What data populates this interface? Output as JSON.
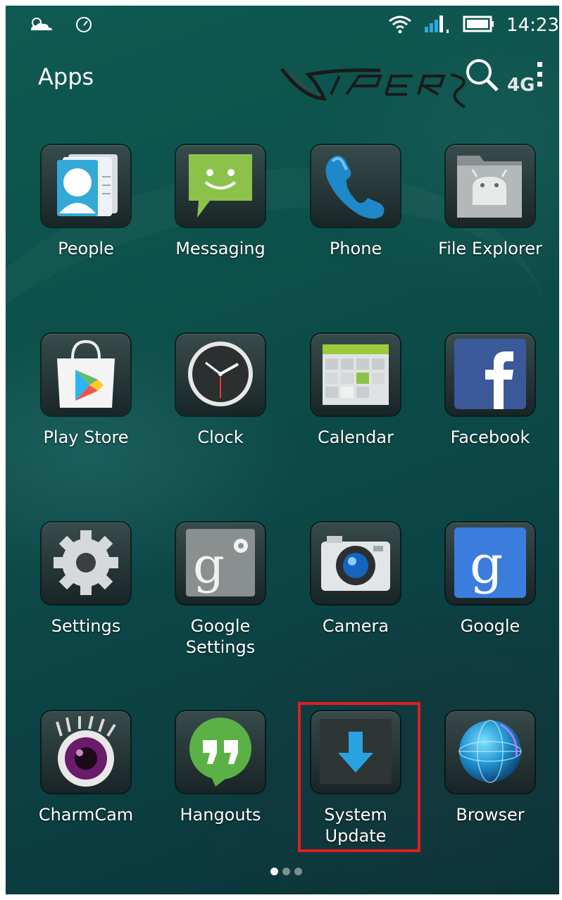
{
  "status_bar": {
    "time": "14:23",
    "icons": [
      "weather-icon",
      "speed-icon",
      "wifi-icon",
      "signal-icon",
      "battery-icon"
    ]
  },
  "header": {
    "title": "Apps",
    "brand": "4G",
    "actions": [
      "search-icon",
      "overflow-menu-icon"
    ]
  },
  "apps": [
    {
      "label": "People",
      "icon": "people-icon"
    },
    {
      "label": "Messaging",
      "icon": "messaging-icon"
    },
    {
      "label": "Phone",
      "icon": "phone-icon"
    },
    {
      "label": "File Explorer",
      "icon": "file-explorer-icon"
    },
    {
      "label": "Play Store",
      "icon": "play-store-icon"
    },
    {
      "label": "Clock",
      "icon": "clock-icon"
    },
    {
      "label": "Calendar",
      "icon": "calendar-icon"
    },
    {
      "label": "Facebook",
      "icon": "facebook-icon"
    },
    {
      "label": "Settings",
      "icon": "gear-icon"
    },
    {
      "label": "Google\nSettings",
      "icon": "google-settings-icon"
    },
    {
      "label": "Camera",
      "icon": "camera-icon"
    },
    {
      "label": "Google",
      "icon": "google-icon"
    },
    {
      "label": "CharmCam",
      "icon": "charmcam-icon"
    },
    {
      "label": "Hangouts",
      "icon": "hangouts-icon"
    },
    {
      "label": "System\nUpdate",
      "icon": "system-update-icon"
    },
    {
      "label": "Browser",
      "icon": "browser-icon"
    }
  ],
  "page_indicator": {
    "pages": 3,
    "current": 1
  },
  "colors": {
    "highlight": "#e01e1e",
    "wallpaper": "#0d4f4a"
  }
}
